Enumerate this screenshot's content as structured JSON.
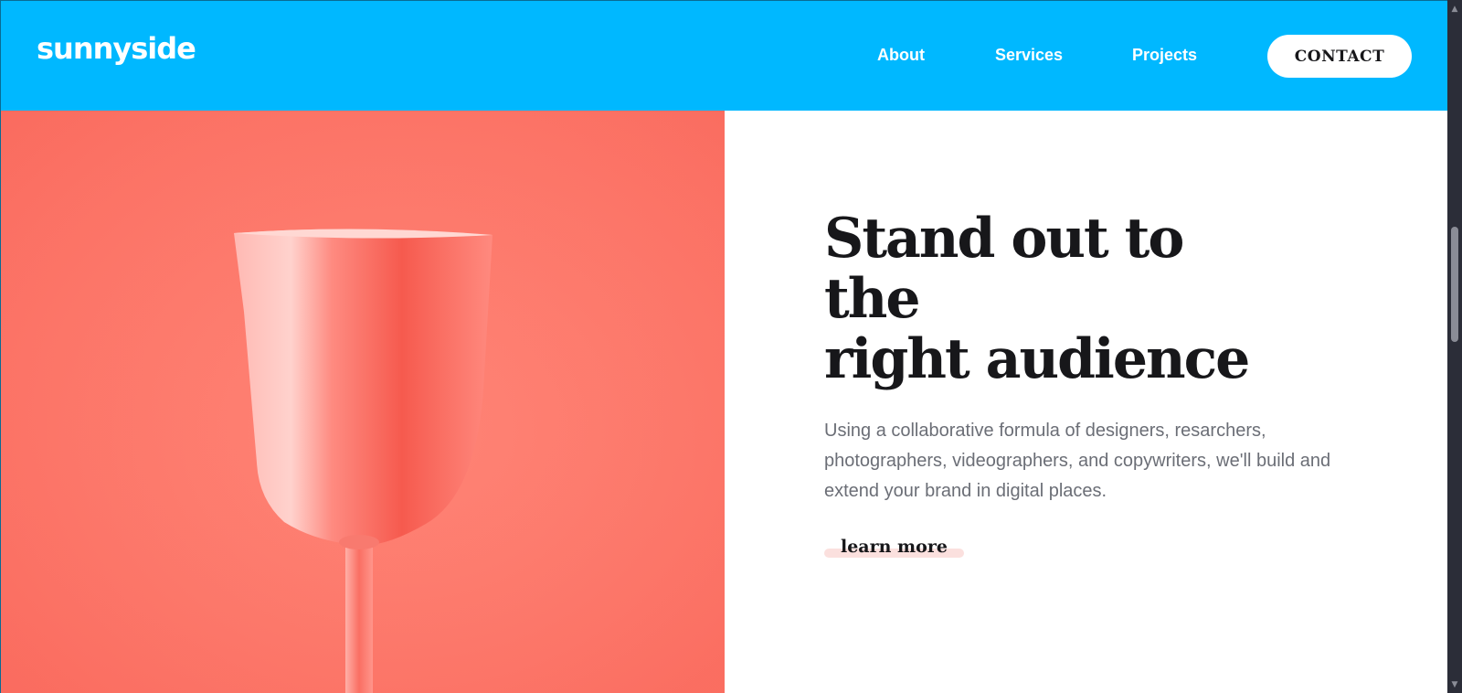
{
  "header": {
    "logo": "sunnyside",
    "nav": {
      "about": "About",
      "services": "Services",
      "projects": "Projects"
    },
    "contact_label": "CONTACT"
  },
  "hero": {
    "heading_line1": "Stand out to the",
    "heading_line2": "right audience",
    "body": "Using a collaborative formula of designers, resarchers, photographers, videographers, and copywriters, we'll build and extend your brand in digital places.",
    "cta": "learn more"
  },
  "colors": {
    "header_bg": "#00b8ff",
    "hero_image_bg": "#fd7a6c",
    "cta_underline": "#fbe0de",
    "heading_text": "#17171a",
    "body_text": "#6b6e76"
  },
  "icons": {
    "scroll_up": "triangle-up-icon",
    "scroll_down": "triangle-down-icon"
  }
}
